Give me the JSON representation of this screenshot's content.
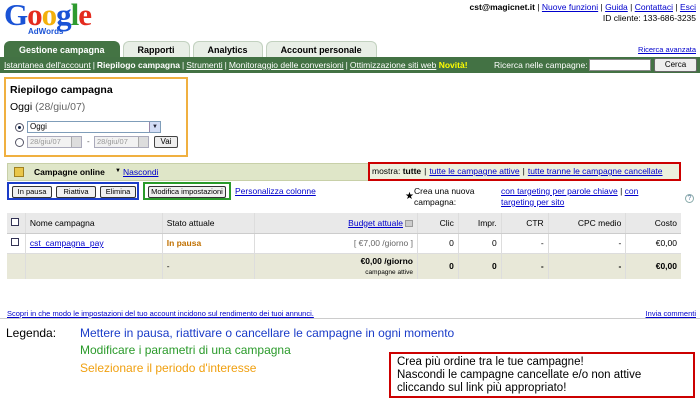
{
  "logo": {
    "letters": [
      "G",
      "o",
      "o",
      "g",
      "l",
      "e"
    ],
    "sub": "AdWords"
  },
  "account": {
    "email": "cst@magicnet.it",
    "links": [
      "Nuove funzioni",
      "Guida",
      "Contattaci",
      "Esci"
    ],
    "client_id": "ID cliente: 133-686-3235"
  },
  "tabs": [
    "Gestione campagna",
    "Rapporti",
    "Analytics",
    "Account personale"
  ],
  "advanced_search": "Ricerca avanzata",
  "nav": {
    "links": [
      "Istantanea dell'account",
      "Riepilogo campagna",
      "Strumenti",
      "Monitoraggio delle conversioni",
      "Ottimizzazione siti web"
    ],
    "new_badge": "Novità!",
    "search_label": "Ricerca nelle campagne:",
    "search_button": "Cerca",
    "search_value": ""
  },
  "summary": {
    "title": "Riepilogo campagna",
    "date_label": "Oggi",
    "date_value": "(28/giu/07)",
    "select_value": "Oggi",
    "date_from": "28/giu/07",
    "date_to": "28/giu/07",
    "go_button": "Vai"
  },
  "campaigns_bar": {
    "title": "Campagne online",
    "hide_link": "Nascondi",
    "show_label": "mostra:",
    "show_all": "tutte",
    "show_active": "tutte le campagne attive",
    "show_not_deleted": "tutte tranne le campagne cancellate"
  },
  "actions": {
    "pause": "In pausa",
    "activate": "Riattiva",
    "delete": "Elimina",
    "edit_settings": "Modifica impostazioni",
    "customize_columns": "Personalizza colonne"
  },
  "create": {
    "label": "Crea una nuova campagna:",
    "keyword_targeting": "con targeting per parole chiave",
    "site_targeting_a": "con",
    "site_targeting_b": "targeting per sito",
    "help": "?"
  },
  "table": {
    "headers": [
      "Nome campagna",
      "Stato attuale",
      "Budget attuale",
      "Clic",
      "Impr.",
      "CTR",
      "CPC medio",
      "Costo"
    ],
    "rows": [
      {
        "name": "cst_campagna_pay",
        "status": "In pausa",
        "budget": "[ €7,00 /giorno ]",
        "clicks": "0",
        "impr": "0",
        "ctr": "-",
        "cpc": "-",
        "cost": "€0,00"
      }
    ],
    "total": {
      "status": "-",
      "budget": "€0,00 /giorno",
      "budget_note": "campagne attive",
      "clicks": "0",
      "impr": "0",
      "ctr": "-",
      "cpc": "-",
      "cost": "€0,00"
    }
  },
  "footer": {
    "settings_link": "Scopri in che modo le impostazioni del tuo account incidono sul rendimento dei tuoi annunci.",
    "comments": "Invia commenti"
  },
  "legend": {
    "title": "Legenda:",
    "items": [
      "Mettere in pausa, riattivare o cancellare le campagne in ogni momento",
      "Modificare i parametri di una campagna",
      "Selezionare il periodo d'interesse"
    ]
  },
  "note": [
    "Crea più ordine tra le tue campagne!",
    "Nascondi le campagne cancellate e/o non attive",
    "cliccando sul link più appropriato!"
  ],
  "colors": {
    "brand_green": "#437244",
    "legend_blue": "#1a3cc8",
    "legend_green": "#2a9a2a",
    "legend_orange": "#f0a010",
    "highlight_red": "#cc0000"
  }
}
